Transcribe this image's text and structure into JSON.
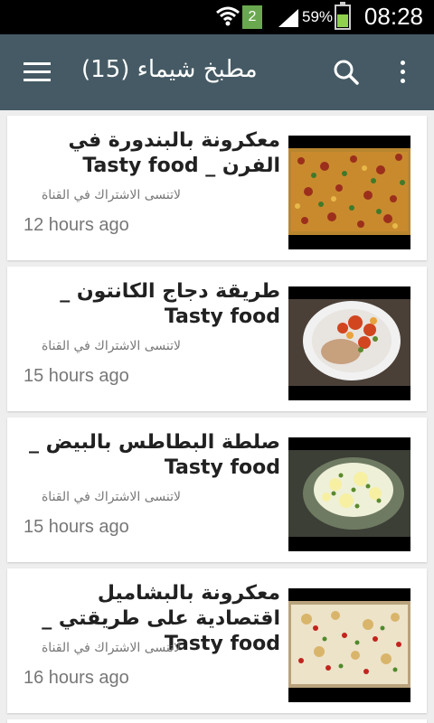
{
  "status_bar": {
    "clock": "08:28",
    "battery_percent": "59%",
    "notification_badge": "2",
    "battery_level": 0.59,
    "battery_color": "#8fd14f",
    "badge_color": "#6aa84f"
  },
  "toolbar": {
    "title": "مطبخ شيماء (15)",
    "menu_icon": "hamburger-menu-icon",
    "search_icon": "search-icon",
    "more_icon": "more-vert-icon",
    "background": "#455a64"
  },
  "videos": [
    {
      "title": "معكرونة بالبندورة في الفرن _ Tasty food",
      "subtitle": "لاتنسى الاشتراك في القناة",
      "time": "12 hours ago"
    },
    {
      "title": "طريقة دجاج الكانتون _ Tasty food",
      "subtitle": "لاتنسى الاشتراك في القناة",
      "time": "15 hours ago"
    },
    {
      "title": "صلطة البطاطس بالبيض _ Tasty food",
      "subtitle": "لاتنسى الاشتراك في القناة",
      "time": "15 hours ago"
    },
    {
      "title": "معكرونة بالبشاميل اقتصادية على طريقتي _ Tasty food",
      "subtitle": "لاتنسى الاشتراك في القناة",
      "time": "16 hours ago"
    }
  ]
}
